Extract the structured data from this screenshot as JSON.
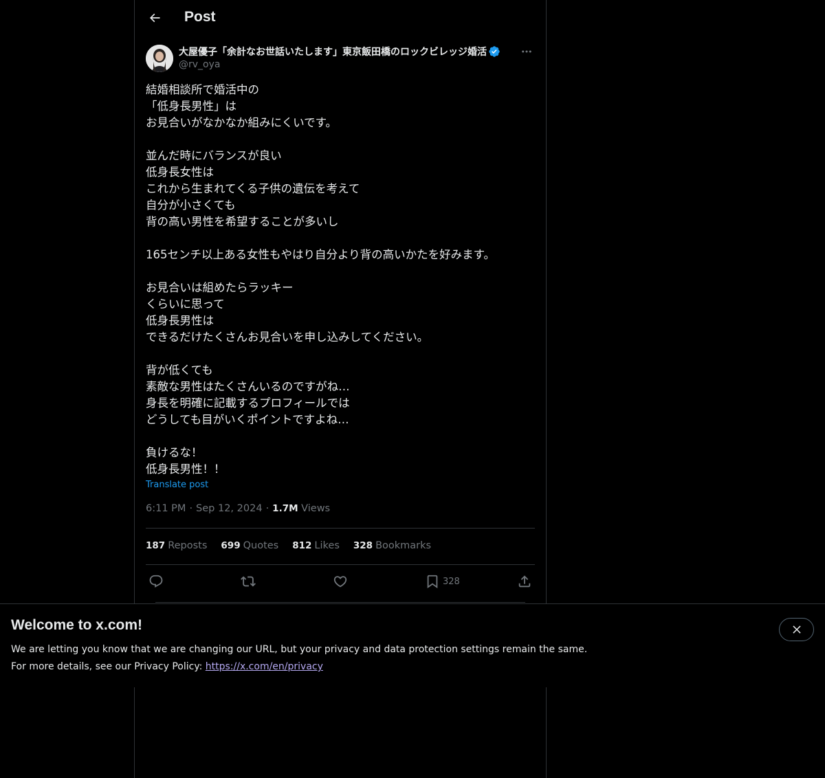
{
  "header": {
    "title": "Post"
  },
  "author": {
    "display_name": "大屋優子「余計なお世話いたします」東京飯田橋のロックビレッジ婚活",
    "handle": "@rv_oya",
    "verified": true
  },
  "post": {
    "lines": [
      "結婚相談所で婚活中の",
      "「低身長男性」は",
      "お見合いがなかなか組みにくいです。",
      "",
      "並んだ時にバランスが良い",
      "低身長女性は",
      "これから生まれてくる子供の遺伝を考えて",
      "自分が小さくても",
      "背の高い男性を希望することが多いし",
      "",
      "165センチ以上ある女性もやはり自分より背の高いかたを好みます。",
      "",
      "お見合いは組めたらラッキー",
      "くらいに思って",
      "低身長男性は",
      "できるだけたくさんお見合いを申し込みしてください。",
      "",
      "背が低くても",
      "素敵な男性はたくさんいるのですがね…",
      "身長を明確に記載するプロフィールでは",
      "どうしても目がいくポイントですよね…",
      "",
      "負けるな！",
      "低身長男性！！"
    ],
    "translate_label": "Translate post",
    "time": "6:11 PM",
    "date": "Sep 12, 2024",
    "views_count": "1.7M",
    "views_label": "Views"
  },
  "stats": {
    "reposts": {
      "count": "187",
      "label": "Reposts"
    },
    "quotes": {
      "count": "699",
      "label": "Quotes"
    },
    "likes": {
      "count": "812",
      "label": "Likes"
    },
    "bookmarks": {
      "count": "328",
      "label": "Bookmarks"
    }
  },
  "actions": {
    "bookmark_count": "328"
  },
  "banner": {
    "title": "Welcome to x.com!",
    "line1": "We are letting you know that we are changing our URL, but your privacy and data protection settings remain the same.",
    "line2_prefix": "For more details, see our Privacy Policy: ",
    "link_text": "https://x.com/en/privacy"
  },
  "colors": {
    "background": "#000000",
    "text": "#e7e9ea",
    "muted": "#71767b",
    "border": "#2f3336",
    "accent": "#1d9bf0",
    "link": "#b5a9f2"
  },
  "icons": {
    "back": "arrow-left-icon",
    "verified": "verified-badge-icon",
    "more": "more-horizontal-icon",
    "reply": "reply-icon",
    "repost": "repost-icon",
    "like": "heart-icon",
    "bookmark": "bookmark-icon",
    "share": "share-icon",
    "close": "close-icon"
  }
}
